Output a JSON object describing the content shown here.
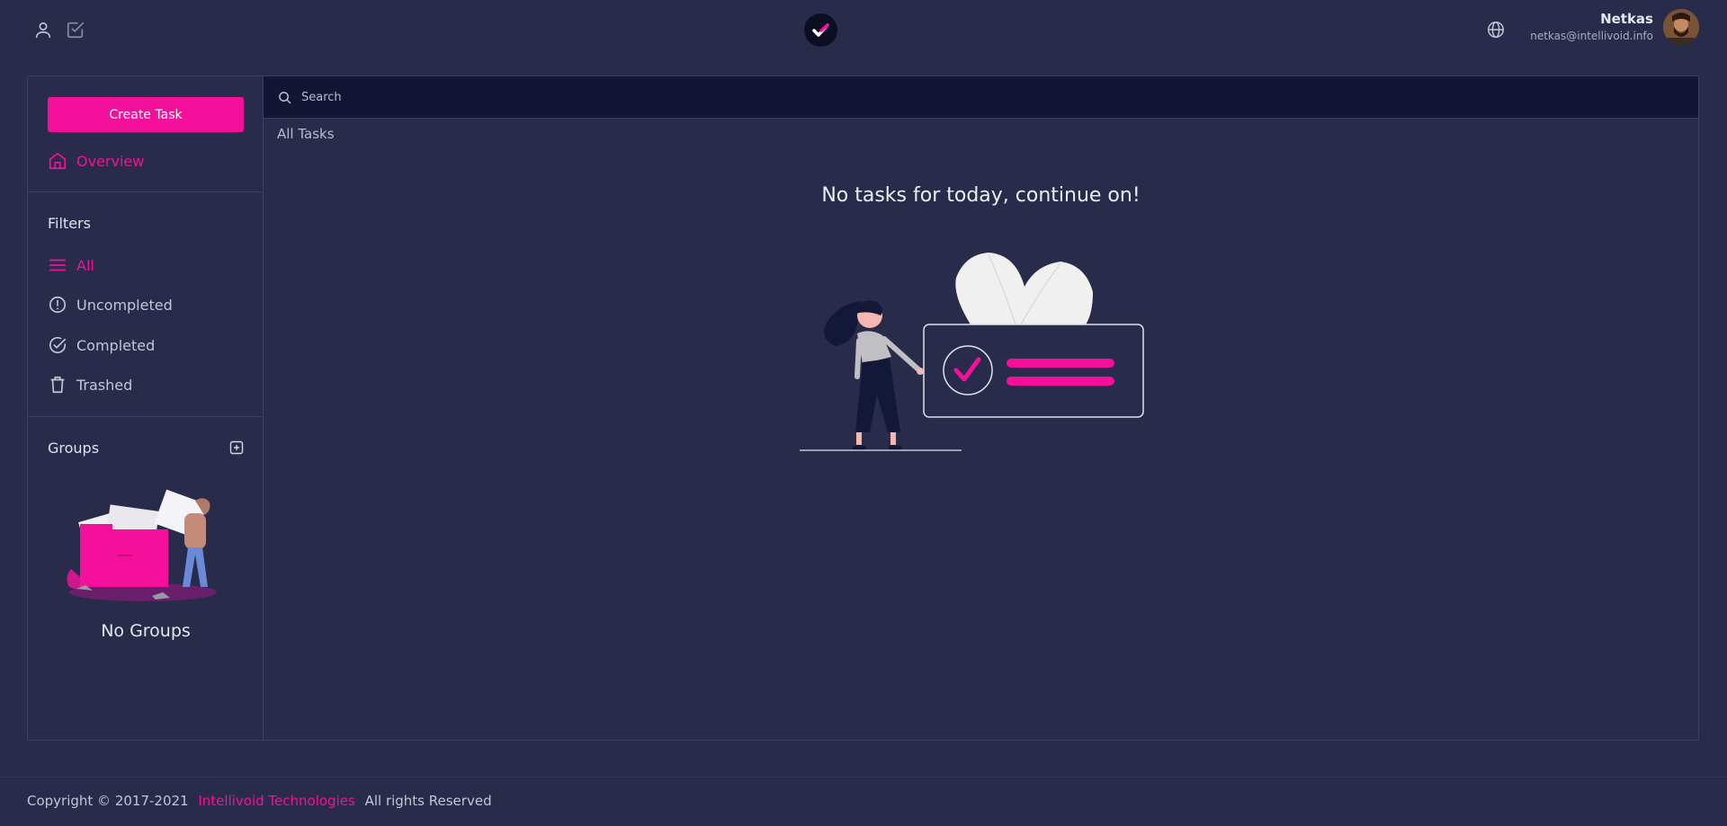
{
  "user": {
    "name": "Netkas",
    "email": "netkas@intellivoid.info"
  },
  "sidebar": {
    "create_label": "Create Task",
    "overview_label": "Overview",
    "filters_title": "Filters",
    "filters": [
      {
        "label": "All",
        "icon": "menu-lines-icon",
        "active": true
      },
      {
        "label": "Uncompleted",
        "icon": "alert-circle-icon",
        "active": false
      },
      {
        "label": "Completed",
        "icon": "check-circle-icon",
        "active": false
      },
      {
        "label": "Trashed",
        "icon": "trash-icon",
        "active": false
      }
    ],
    "groups_title": "Groups",
    "no_groups": "No Groups"
  },
  "search": {
    "placeholder": "Search"
  },
  "main": {
    "section_label": "All Tasks",
    "empty_message": "No tasks for today, continue on!"
  },
  "footer": {
    "copyright": "Copyright © 2017-2021",
    "company": "Intellivoid Technologies",
    "rights": "All rights Reserved"
  },
  "colors": {
    "accent": "#f4109a",
    "background": "#282c4a",
    "search_bg": "#121634"
  }
}
